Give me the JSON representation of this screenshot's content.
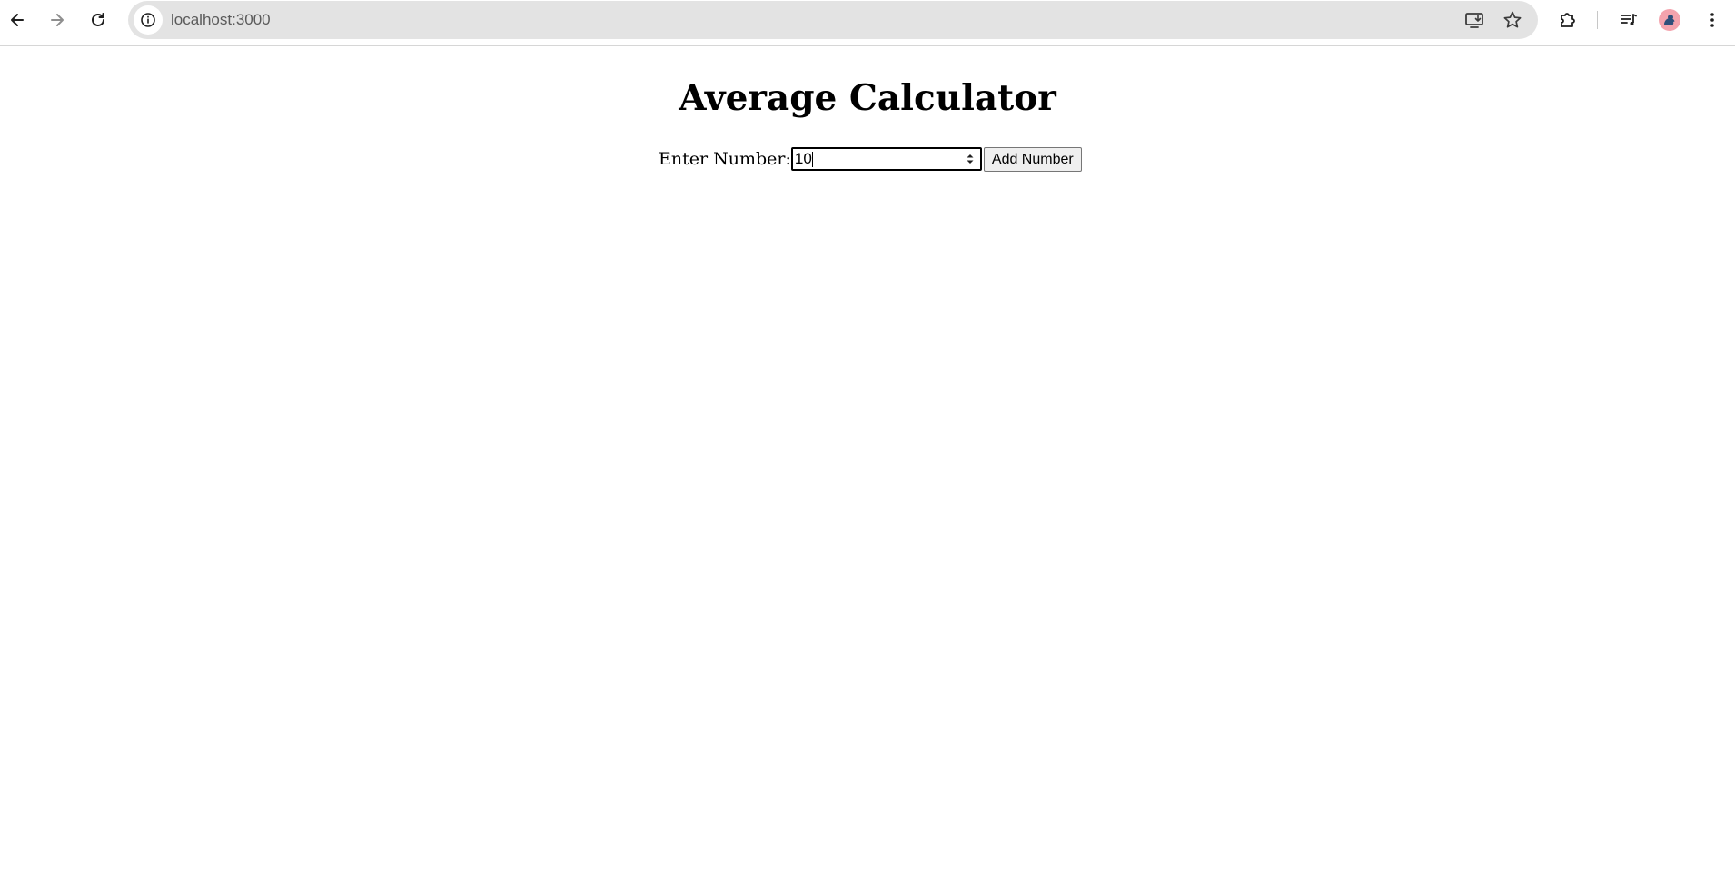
{
  "browser": {
    "url": "localhost:3000",
    "icons": {
      "back": "arrow-left-icon",
      "forward": "arrow-right-icon",
      "reload": "reload-icon",
      "site_info": "info-icon",
      "install": "install-app-icon",
      "bookmark": "star-icon",
      "extensions": "puzzle-icon",
      "media": "media-queue-icon",
      "profile": "avatar",
      "menu": "kebab-menu-icon"
    }
  },
  "page": {
    "title": "Average Calculator",
    "form": {
      "label": "Enter Number:",
      "input_value": "10",
      "button_label": "Add Number"
    }
  },
  "colors": {
    "omnibox_bg": "#e3e3e3",
    "avatar_bg": "#f4a3ad",
    "button_bg": "#efefef"
  }
}
